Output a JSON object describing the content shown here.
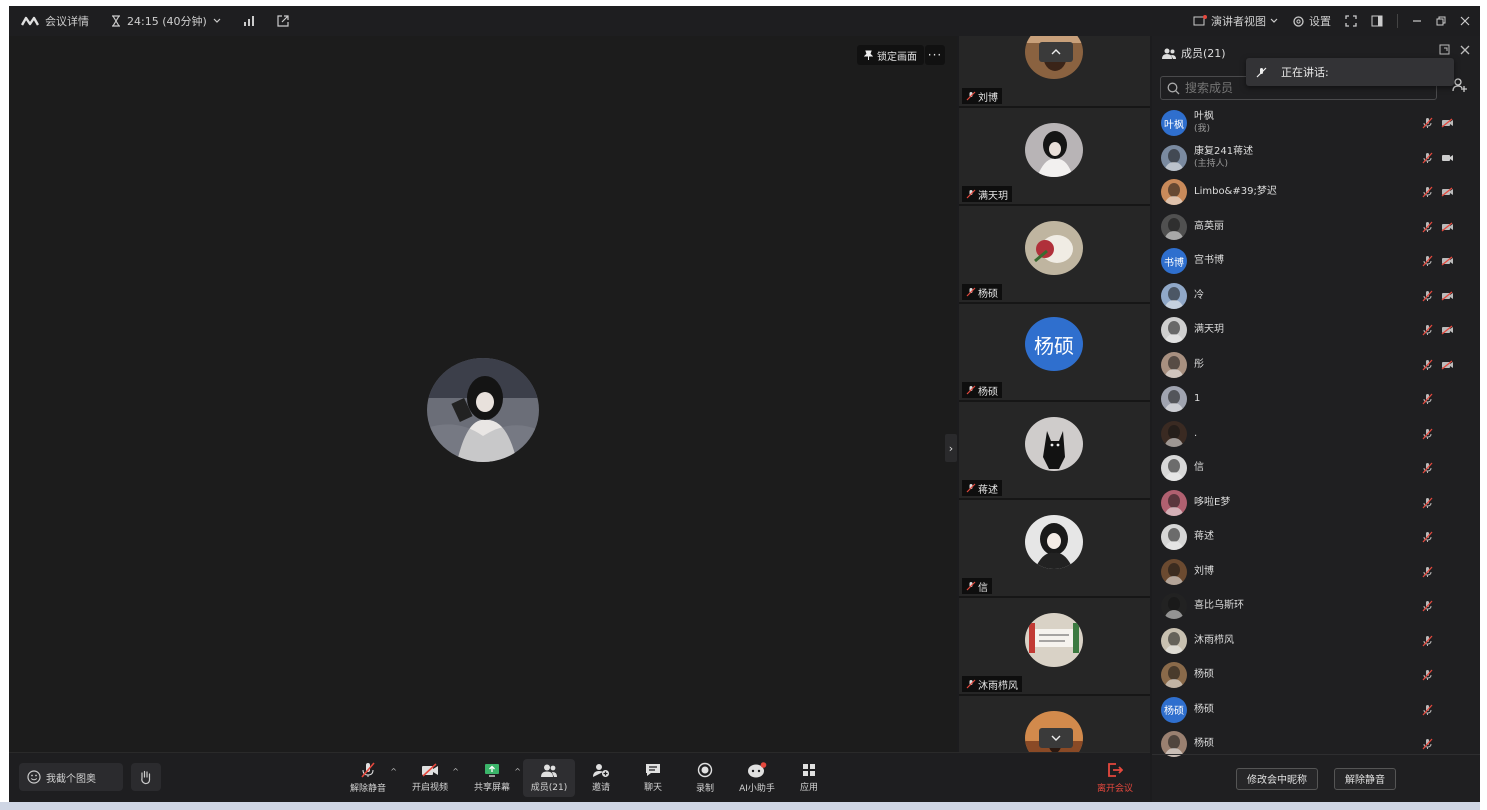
{
  "topbar": {
    "meeting_details": "会议详情",
    "timer": "24:15 (40分钟)",
    "presenter_view": "演讲者视图",
    "settings": "设置"
  },
  "main": {
    "lock_label": "锁定画面",
    "more_label": "···"
  },
  "strip": {
    "tiles": [
      {
        "name": "刘博"
      },
      {
        "name": "满天玥"
      },
      {
        "name": "杨硕"
      },
      {
        "name": "杨硕",
        "avatar_text": "杨硕"
      },
      {
        "name": "蒋述"
      },
      {
        "name": "信"
      },
      {
        "name": "沐雨栉风"
      }
    ]
  },
  "panel": {
    "title": "成员(21)",
    "search_placeholder": "搜索成员",
    "speaking_label": "正在讲话:",
    "members": [
      {
        "name": "叶枫",
        "sub": "(我)",
        "avatar_text": "叶枫",
        "video": "off"
      },
      {
        "name": "康复241蒋述",
        "sub": "(主持人)",
        "video": "on"
      },
      {
        "name": "Limbo&#39;梦迟",
        "video": "off"
      },
      {
        "name": "高英丽",
        "video": "off"
      },
      {
        "name": "宫书博",
        "avatar_text": "书博",
        "video": "off"
      },
      {
        "name": "冷",
        "video": "off"
      },
      {
        "name": "满天玥",
        "video": "off"
      },
      {
        "name": "彤",
        "video": "off"
      },
      {
        "name": "1",
        "video": "none"
      },
      {
        "name": ".",
        "video": "none"
      },
      {
        "name": "信",
        "video": "none"
      },
      {
        "name": "哆啦E梦",
        "video": "none"
      },
      {
        "name": "蒋述",
        "video": "none"
      },
      {
        "name": "刘博",
        "video": "none"
      },
      {
        "name": "喜比乌斯环",
        "video": "none"
      },
      {
        "name": "沐雨栉风",
        "video": "none"
      },
      {
        "name": "杨硕",
        "video": "none"
      },
      {
        "name": "杨硕",
        "avatar_text": "杨硕",
        "video": "none"
      },
      {
        "name": "杨硕",
        "video": "none"
      }
    ],
    "rename_label": "修改会中昵称",
    "unmute_all_label": "解除静音"
  },
  "bottombar": {
    "chat_placeholder": "我截个图奥",
    "tools": [
      {
        "label": "解除静音"
      },
      {
        "label": "开启视频"
      },
      {
        "label": "共享屏幕"
      },
      {
        "label": "成员(21)"
      },
      {
        "label": "邀请"
      },
      {
        "label": "聊天"
      },
      {
        "label": "录制"
      },
      {
        "label": "AI小助手"
      },
      {
        "label": "应用"
      }
    ],
    "leave_label": "离开会议"
  },
  "colors": {
    "background": "#1c1c1e",
    "accent_blue": "#2f6fce",
    "leave_red": "#e5483d"
  }
}
